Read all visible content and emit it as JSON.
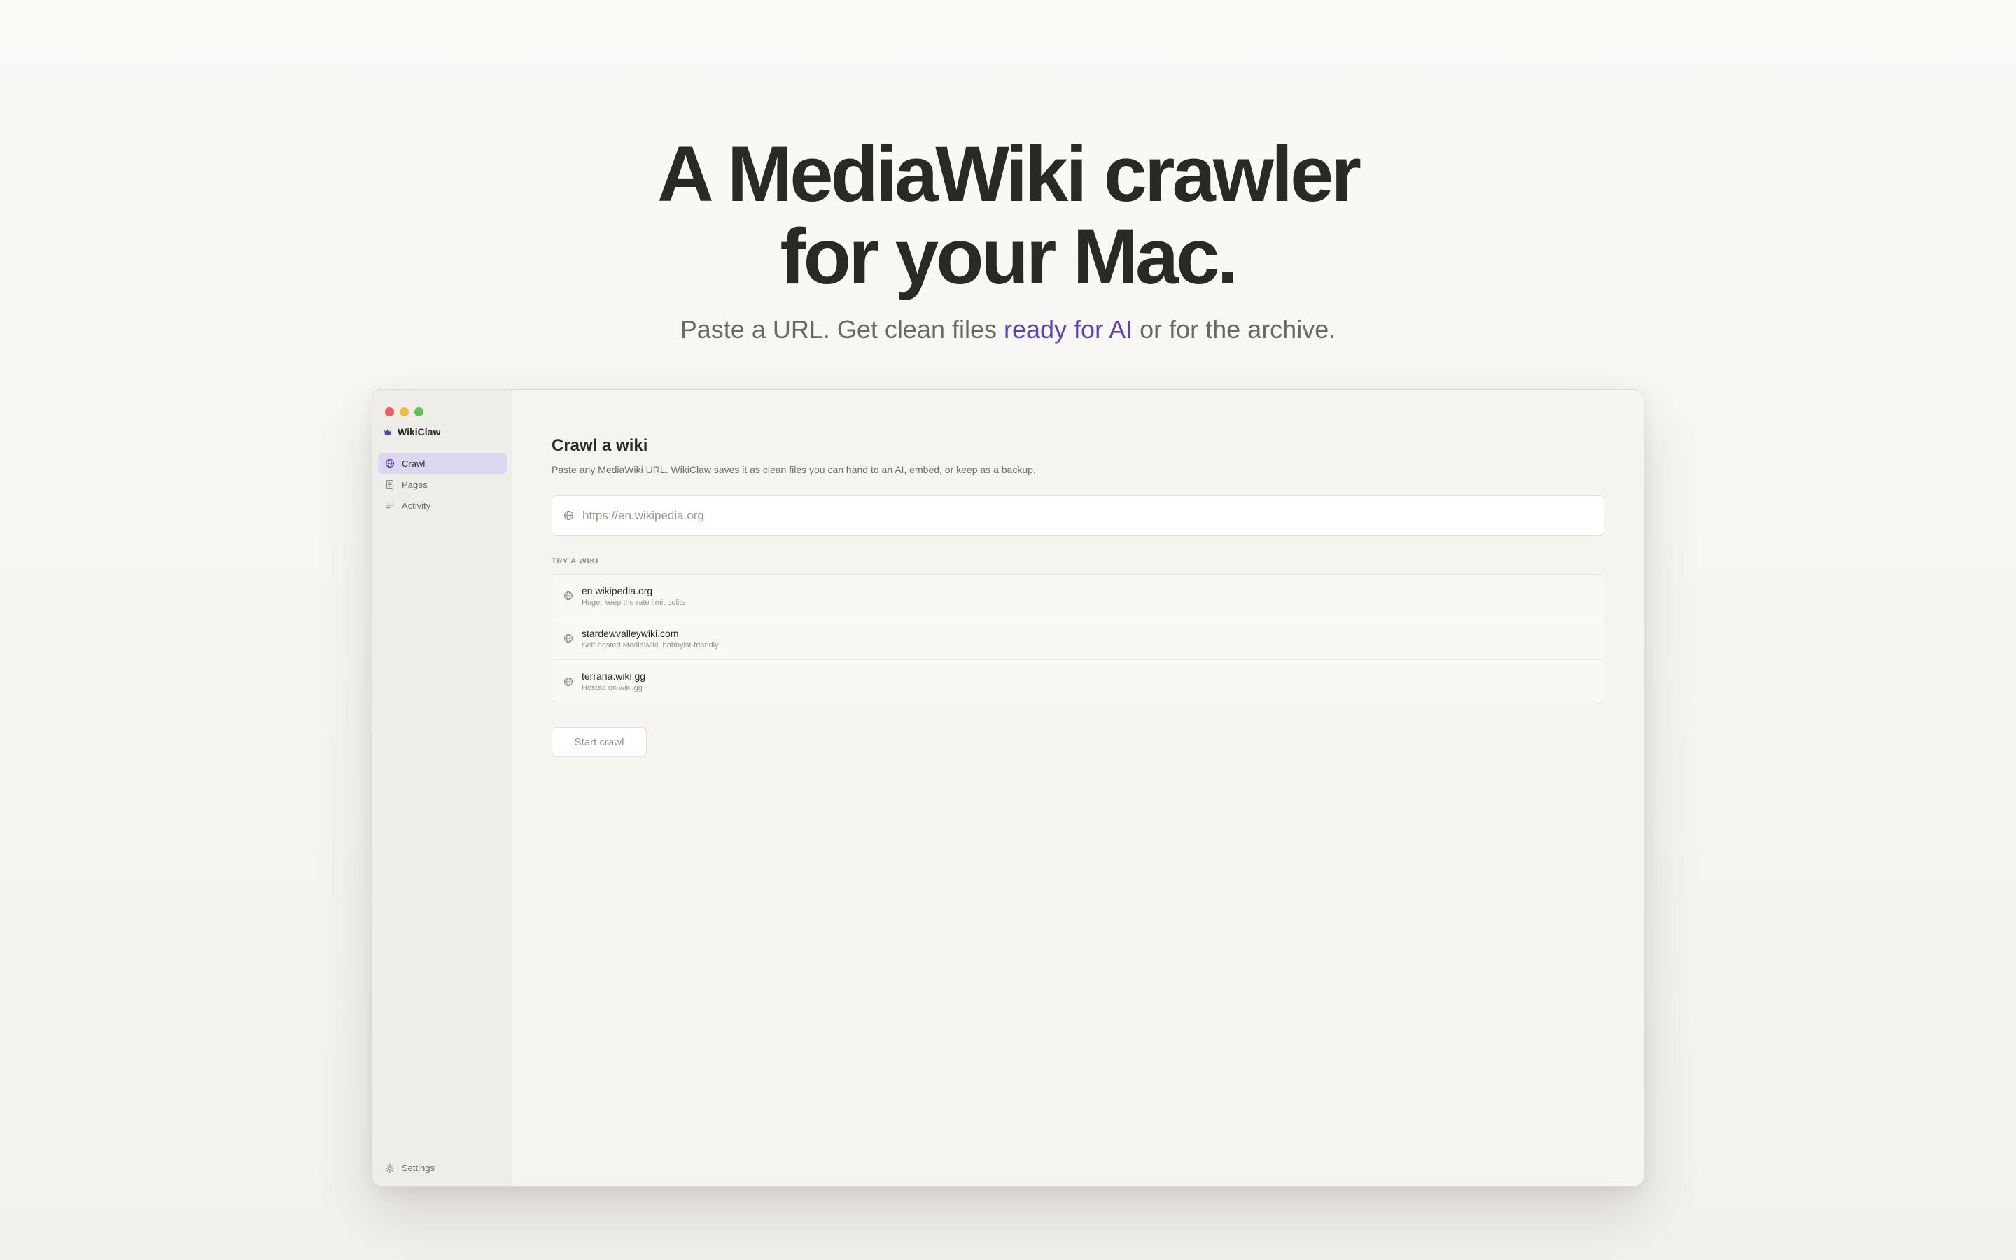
{
  "hero": {
    "title_line1": "A MediaWiki crawler",
    "title_line2": "for your Mac.",
    "subtitle_before": "Paste a URL. Get clean files ",
    "subtitle_accent": "ready for AI",
    "subtitle_after": " or for the archive."
  },
  "app": {
    "name": "WikiClaw",
    "brand_icon": "crown-icon",
    "accent_color": "#5a3fc4"
  },
  "sidebar": {
    "items": [
      {
        "label": "Crawl",
        "icon": "globe-icon",
        "active": true
      },
      {
        "label": "Pages",
        "icon": "document-icon",
        "active": false
      },
      {
        "label": "Activity",
        "icon": "list-icon",
        "active": false
      }
    ],
    "settings_label": "Settings"
  },
  "main": {
    "title": "Crawl a wiki",
    "description": "Paste any MediaWiki URL. WikiClaw saves it as clean files you can hand to an AI, embed, or keep as a backup.",
    "url_placeholder": "https://en.wikipedia.org",
    "url_value": "",
    "try_label": "TRY A WIKI",
    "wikis": [
      {
        "name": "en.wikipedia.org",
        "note": "Huge, keep the rate limit polite"
      },
      {
        "name": "stardewvalleywiki.com",
        "note": "Self-hosted MediaWiki, hobbyist-friendly"
      },
      {
        "name": "terraria.wiki.gg",
        "note": "Hosted on wiki.gg"
      }
    ],
    "start_button": "Start crawl"
  }
}
